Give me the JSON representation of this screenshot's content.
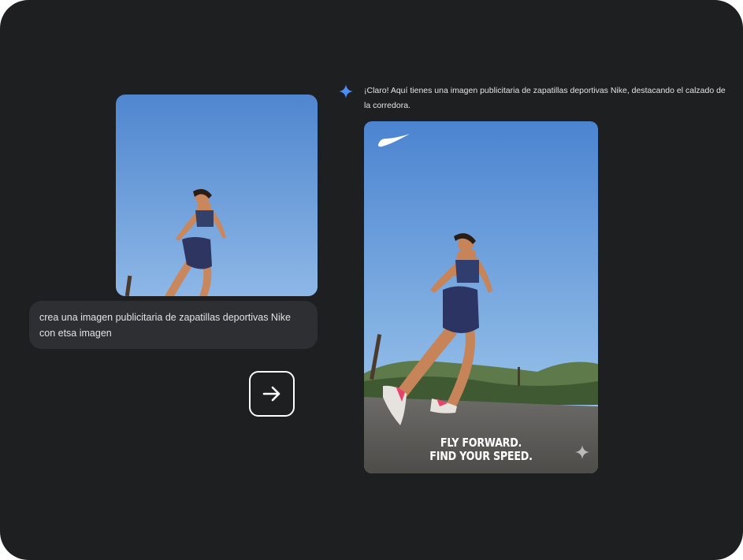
{
  "conversation": {
    "user": {
      "image": "user-uploaded-runner-photo",
      "prompt": "crea una imagen publicitaria de zapatillas deportivas Nike con etsa imagen"
    },
    "send_icon": "arrow-right-icon",
    "model": {
      "icon": "sparkle-icon",
      "response_text": "¡Claro! Aquí tienes una imagen publicitaria de zapatillas deportivas Nike, destacando el calzado de la corredora.",
      "ad": {
        "logo": "nike-swoosh",
        "tagline_line1": "FLY FORWARD.",
        "tagline_line2": "FIND YOUR SPEED.",
        "watermark": "sparkle-watermark-icon"
      }
    }
  },
  "colors": {
    "background": "#1e1f21",
    "bubble": "#2e2f33",
    "accent_sparkle": "#4c8df6",
    "sky": "#5b93d8",
    "text": "#e3e3e3"
  }
}
